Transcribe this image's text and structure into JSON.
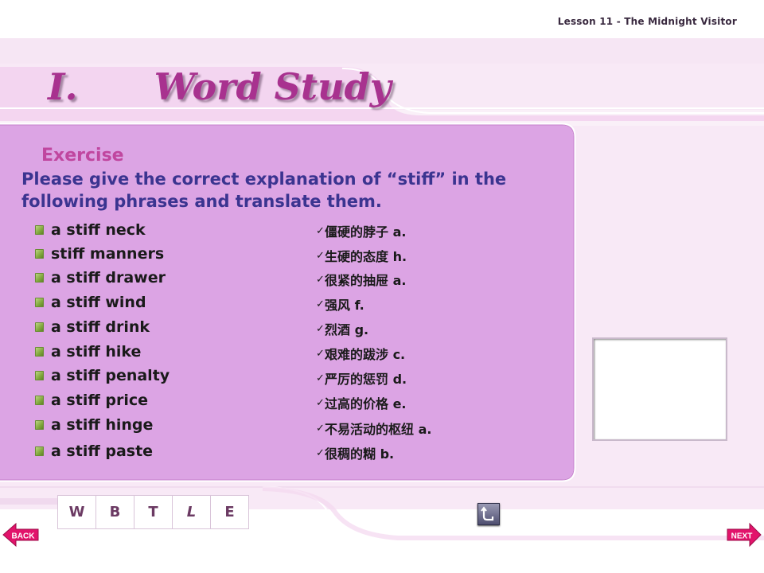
{
  "header": {
    "lesson": "Lesson 11 - The Midnight Visitor"
  },
  "title": {
    "number": "I.",
    "text": "Word Study"
  },
  "exercise": {
    "label": "Exercise",
    "instruction": "Please give the correct explanation of “stiff” in the following phrases and translate them.",
    "items": [
      {
        "phrase": "a stiff neck",
        "answer": "僵硬的脖子 a."
      },
      {
        "phrase": "stiff manners",
        "answer": "生硬的态度 h."
      },
      {
        "phrase": "a stiff drawer",
        "answer": "很紧的抽屉 a."
      },
      {
        "phrase": "a stiff wind",
        "answer": "强风 f."
      },
      {
        "phrase": "a stiff drink",
        "answer": "烈酒 g."
      },
      {
        "phrase": "a stiff hike",
        "answer": "艰难的跋涉 c."
      },
      {
        "phrase": "a stiff penalty",
        "answer": "严厉的惩罚 d."
      },
      {
        "phrase": "a stiff price",
        "answer": "过高的价格 e."
      },
      {
        "phrase": "a stiff hinge",
        "answer": "不易活动的枢纽 a."
      },
      {
        "phrase": "a stiff paste",
        "answer": "很稠的糊 b."
      }
    ]
  },
  "nav": {
    "letters": [
      "W",
      "B",
      "T",
      "L",
      "E"
    ],
    "back_label": "BACK",
    "next_label": "NEXT"
  },
  "colors": {
    "panel": "#dca4e4",
    "title": "#a8328f",
    "instruction": "#3b3490",
    "exercise_label": "#c0469f",
    "arrow": "#e2136b"
  }
}
